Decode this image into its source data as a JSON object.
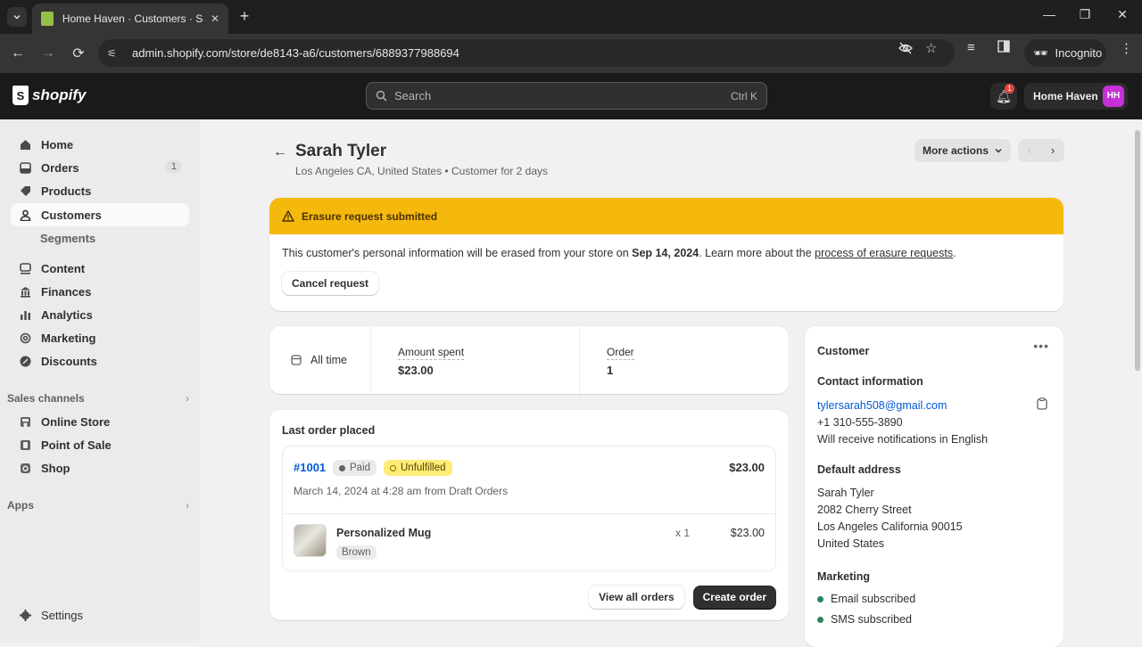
{
  "browser": {
    "tab_title": "Home Haven · Customers · Sarah Tyler",
    "url": "admin.shopify.com/store/de8143-a6/customers/6889377988694",
    "profile_label": "Incognito"
  },
  "topbar": {
    "brand": "shopify",
    "search_placeholder": "Search",
    "search_shortcut": "Ctrl K",
    "notification_count": "1",
    "store_name": "Home Haven",
    "store_initials": "HH"
  },
  "sidebar": {
    "items": [
      {
        "label": "Home",
        "icon": "home-icon"
      },
      {
        "label": "Orders",
        "icon": "inbox-icon",
        "count": "1"
      },
      {
        "label": "Products",
        "icon": "tag-icon"
      },
      {
        "label": "Customers",
        "icon": "person-icon",
        "active": true
      },
      {
        "label": "Content",
        "icon": "image-icon"
      },
      {
        "label": "Finances",
        "icon": "bank-icon"
      },
      {
        "label": "Analytics",
        "icon": "bar-chart-icon"
      },
      {
        "label": "Marketing",
        "icon": "target-icon"
      },
      {
        "label": "Discounts",
        "icon": "discount-icon"
      }
    ],
    "sub_items": [
      "Segments"
    ],
    "sales_channels_label": "Sales channels",
    "sales_channels": [
      {
        "label": "Online Store",
        "icon": "store-icon"
      },
      {
        "label": "Point of Sale",
        "icon": "pos-icon"
      },
      {
        "label": "Shop",
        "icon": "shop-icon"
      }
    ],
    "apps_label": "Apps",
    "settings_label": "Settings"
  },
  "page": {
    "title": "Sarah Tyler",
    "subtitle": "Los Angeles CA, United States • Customer for 2 days",
    "more_actions_label": "More actions"
  },
  "banner": {
    "title": "Erasure request submitted",
    "text_before": "This customer's personal information will be erased from your store on ",
    "date": "Sep 14, 2024",
    "text_middle": ". Learn more about the ",
    "link_text": "process of erasure requests",
    "text_after": ".",
    "button_label": "Cancel request",
    "color": "#f5b90e"
  },
  "stats": {
    "range_label": "All time",
    "amount_spent_label": "Amount spent",
    "amount_spent_value": "$23.00",
    "order_label": "Order",
    "order_value": "1"
  },
  "last_order": {
    "header": "Last order placed",
    "number": "#1001",
    "payment_status": "Paid",
    "fulfillment_status": "Unfulfilled",
    "total": "$23.00",
    "date_line": "March 14, 2024 at 4:28 am from Draft Orders",
    "line_item": {
      "name": "Personalized Mug",
      "variant": "Brown",
      "quantity": "x 1",
      "price": "$23.00"
    },
    "view_all_label": "View all orders",
    "create_label": "Create order"
  },
  "customer_card": {
    "title": "Customer",
    "contact_header": "Contact information",
    "email": "tylersarah508@gmail.com",
    "phone": "+1 310-555-3890",
    "notifications": "Will receive notifications in English",
    "address_header": "Default address",
    "address_lines": [
      "Sarah Tyler",
      "2082 Cherry Street",
      "Los Angeles California 90015",
      "United States"
    ],
    "marketing_header": "Marketing",
    "marketing": [
      "Email subscribed",
      "SMS subscribed"
    ]
  }
}
